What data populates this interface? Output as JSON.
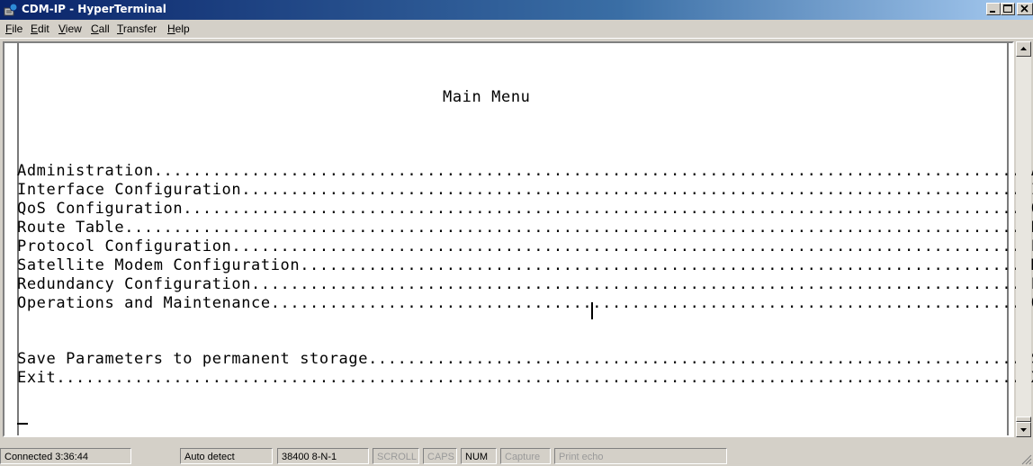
{
  "window": {
    "title": "CDM-IP - HyperTerminal",
    "icon": "hyperterminal-phone-icon",
    "controls": [
      "minimize-icon",
      "maximize-icon",
      "close-icon"
    ]
  },
  "menu": [
    {
      "pre": "",
      "key": "F",
      "post": "ile"
    },
    {
      "pre": "",
      "key": "E",
      "post": "dit"
    },
    {
      "pre": "",
      "key": "V",
      "post": "iew"
    },
    {
      "pre": "",
      "key": "C",
      "post": "all"
    },
    {
      "pre": "",
      "key": "T",
      "post": "ransfer"
    },
    {
      "pre": "",
      "key": "H",
      "post": "elp"
    }
  ],
  "terminal": {
    "heading": "Main Menu",
    "items": [
      {
        "label": "Administration",
        "key": "A"
      },
      {
        "label": "Interface Configuration",
        "key": "I"
      },
      {
        "label": "QoS Configuration",
        "key": "Q"
      },
      {
        "label": "Route Table",
        "key": "R"
      },
      {
        "label": "Protocol Configuration",
        "key": "P"
      },
      {
        "label": "Satellite Modem Configuration",
        "key": "M"
      },
      {
        "label": "Redundancy Configuration",
        "key": "E"
      },
      {
        "label": "Operations and Maintenance",
        "key": "O"
      }
    ],
    "extra_items": [
      {
        "label": "Save Parameters to permanent storage",
        "key": "S"
      },
      {
        "label": "Exit",
        "key": "X"
      }
    ],
    "prompt_cursor": "_"
  },
  "status": {
    "connected": "Connected 3:36:44",
    "detect": "Auto detect",
    "port": "38400 8-N-1",
    "scroll": "SCROLL",
    "caps": "CAPS",
    "num": "NUM",
    "capture": "Capture",
    "print_echo": "Print echo"
  }
}
